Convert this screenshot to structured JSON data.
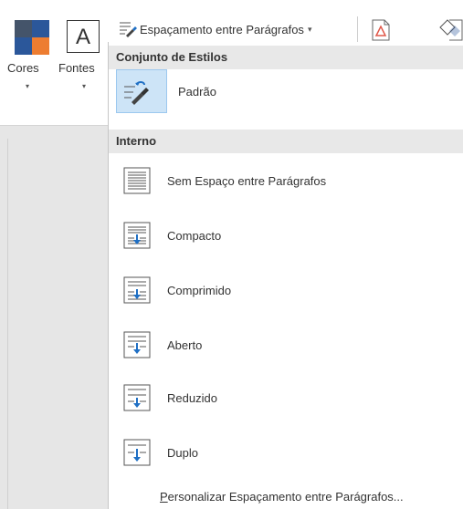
{
  "ribbon": {
    "cores_label": "Cores",
    "fontes_label": "Fontes",
    "fontes_glyph": "A",
    "spacing_button_label": "Espaçamento entre Parágrafos",
    "dropdown_caret": "▾"
  },
  "menu": {
    "section1_title": "Conjunto de Estilos",
    "section2_title": "Interno",
    "items": [
      {
        "label": "Padrão",
        "icon": "brush-spacing-icon"
      },
      {
        "label": "Sem Espaço entre Parágrafos",
        "icon": "no-spacing-icon"
      },
      {
        "label": "Compacto",
        "icon": "compact-spacing-icon"
      },
      {
        "label": "Comprimido",
        "icon": "tight-spacing-icon"
      },
      {
        "label": "Aberto",
        "icon": "open-spacing-icon"
      },
      {
        "label": "Reduzido",
        "icon": "relaxed-spacing-icon"
      },
      {
        "label": "Duplo",
        "icon": "double-spacing-icon"
      }
    ],
    "footer_access_key": "P",
    "footer_rest": "ersonalizar Espaçamento entre Parágrafos..."
  },
  "colors": {
    "accent_blue": "#2b579a",
    "orange": "#ed7d31",
    "slate": "#44546a",
    "arrow_blue": "#1f6fc4",
    "selected_bg": "#cde4f7"
  }
}
